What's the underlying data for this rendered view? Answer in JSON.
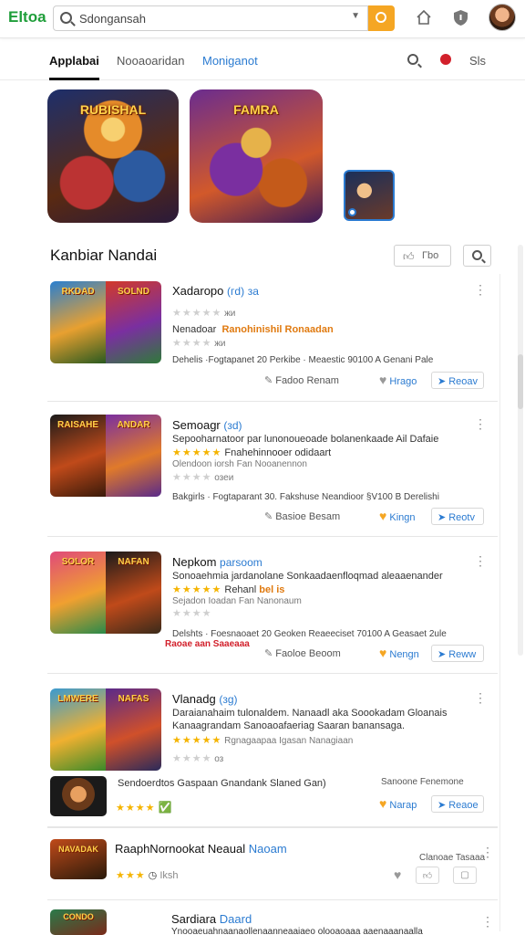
{
  "app": {
    "logo": "Eltoa"
  },
  "search": {
    "value": "Sdongansah",
    "placeholder": "Sdongansah"
  },
  "tabs": [
    {
      "label": "Applabai"
    },
    {
      "label": "Nooaoaridan"
    },
    {
      "label": "Moniganot"
    }
  ],
  "sort_label": "Sls",
  "featured": [
    {
      "label": "RUBISHAL"
    },
    {
      "label": "FAMRA"
    },
    {
      "label": ""
    }
  ],
  "section": {
    "title": "Kanbiar Nandai",
    "like_label": "Гbo"
  },
  "cards": [
    {
      "title": "Xadaropo",
      "rating_tag": "(гd)",
      "rating_suffix": "за",
      "sub_line": "Nenadoar",
      "highlight": "Ranohinishil Ronaadan",
      "grey_small": "жи",
      "meta": "Dehelis ·Fogtapanet 20 Perkibe  · Meaestic 90100  A Genani Pale",
      "action": "Fadoo Renam",
      "link": "Hrago",
      "review": "Reoav",
      "thumb_a": "RKDAD",
      "thumb_b": "SOLND"
    },
    {
      "title": "Semoagr",
      "rating_tag": "(зd)",
      "line1": "Sepooharnatoor par lunonoueoade bolanenkaade Ail Dafaie",
      "line2": "Fnahehinnooer odidaart",
      "line3": "Olendoon iorsh Fan Nooanennon",
      "grey_small": "озеи",
      "meta": "Bakgirls · Fogtaparant 30. Fakshuse  Neandioor §V100 B Derelishi",
      "action": "Basioe Besam",
      "link": "Kingn",
      "review": "Reotv",
      "thumb_a": "RAISAHE",
      "thumb_b": "ANDAR"
    },
    {
      "title": "Nepkom",
      "title_suffix": "parsoom",
      "line1": "Sonoaehmia jardanolane Sonkaadaenfloqmad aleaaenander",
      "line2": "Rehanl",
      "line2_orange": "bel is",
      "line3": "Sejadon Ioadan Fan Nanonaum",
      "badge": "Raoae aan Saaeaaa",
      "meta": "Delshts · Foesnaoaet 20  Geoken  Reaeeciset 70100 A Geasaet 2ule",
      "action": "Faoloe Beoom",
      "link": "Nengn",
      "review": "Reww",
      "thumb_a": "SOLOR",
      "thumb_b": "NAFAN"
    },
    {
      "title": "Vlanadg",
      "rating_tag": "(зg)",
      "line1": "Daraianahaim tulonaldem. Nanaadl aka  Soookadam Gloanais",
      "line2": "Kanaagrandam Sanoaoafaeriag Saaran banansaga.",
      "line3": "Rgnagaapaa Igasan Nanagiaan",
      "grey_small": "оз",
      "sub_left": "Sendoerdtos Gaspaan Gnandank Slaned Gan)",
      "sub_right": "Sanoone Fenemone",
      "link": "Narap",
      "review": "Reaoe",
      "thumb_a": "LMWERE",
      "thumb_b": "NAFAS"
    },
    {
      "title": "RaaphNornookat",
      "title2": "Neaual",
      "title3": "Naoam",
      "sub_right": "Clanoae  Tasaaa",
      "small": "Iksh",
      "thumb_label": "NAVADAK"
    },
    {
      "title": "Sardiara",
      "title_suffix": "Daard",
      "line1": "Ynooaeuahnaanaollenaanneaaiaeo olooaoaaa aaenaaanaalla",
      "thumb_label": "CONDO"
    }
  ],
  "colors": {
    "accent": "#f5a623",
    "link": "#2b7bd1",
    "logo": "#1f9e3a",
    "notification": "#d2202b"
  },
  "icons": [
    "search-icon",
    "chevron-down-icon",
    "home-icon",
    "shield-icon",
    "bell-icon",
    "thumb-up-icon",
    "more-icon",
    "pencil-icon",
    "heart-icon",
    "share-icon"
  ]
}
